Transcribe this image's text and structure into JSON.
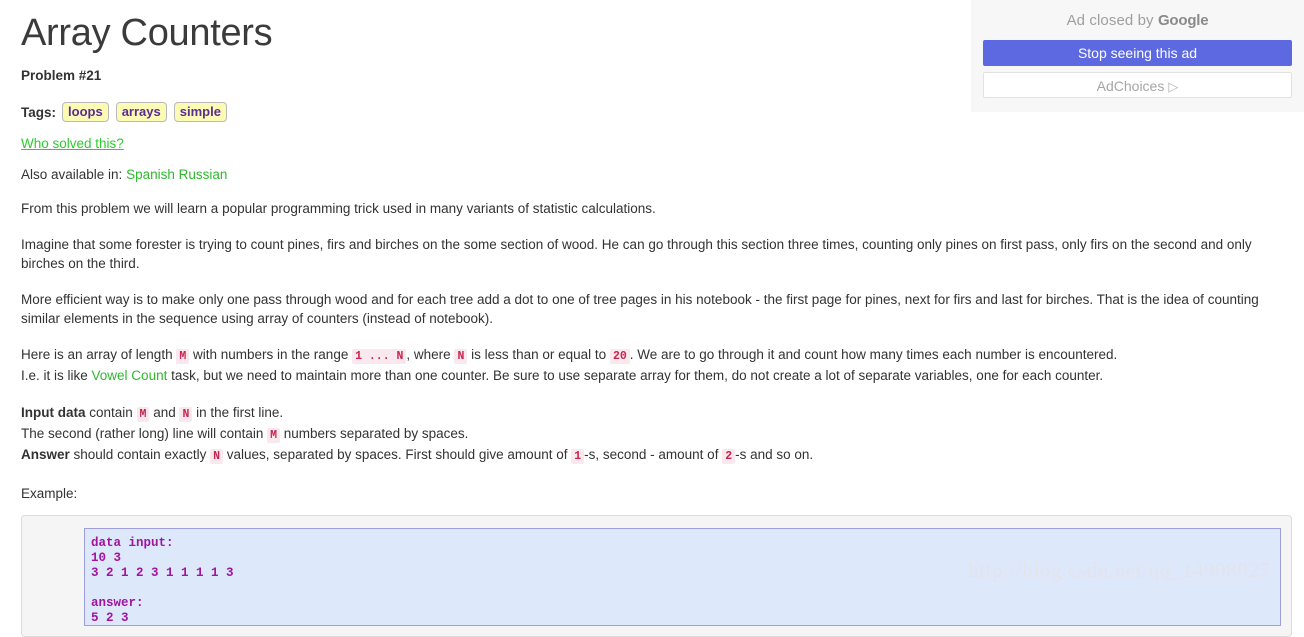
{
  "page": {
    "title": "Array Counters",
    "problem_number": "Problem #21",
    "tags_label": "Tags:",
    "tags": [
      "loops",
      "arrays",
      "simple"
    ],
    "who_solved_link": "Who solved this?",
    "also_available_prefix": "Also available in:",
    "languages": [
      "Spanish",
      "Russian"
    ],
    "example_label": "Example:"
  },
  "ad": {
    "closed_by_prefix": "Ad closed by ",
    "closed_by_brand": "Google",
    "stop_seeing_label": "Stop seeing this ad",
    "adchoices_label": "AdChoices",
    "adchoices_icon": "▷",
    "accent_color": "#5c69e0"
  },
  "paragraphs": {
    "p1": "From this problem we will learn a popular programming trick used in many variants of statistic calculations.",
    "p2": "Imagine that some forester is trying to count pines, firs and birches on the some section of wood. He can go through this section three times, counting only pines on first pass, only firs on the second and only birches on the third.",
    "p3": "More efficient way is to make only one pass through wood and for each tree add a dot to one of tree pages in his notebook - the first page for pines, next for firs and last for birches. That is the idea of counting similar elements in the sequence using array of counters (instead of notebook).",
    "p4_a": "Here is an array of length ",
    "p4_code_M": "M",
    "p4_b": " with numbers in the range ",
    "p4_code_range": "1 ... N",
    "p4_c": ", where ",
    "p4_code_N": "N",
    "p4_d": " is less than or equal to ",
    "p4_code_20": "20",
    "p4_e": ". We are to go through it and count how many times each number is encountered.",
    "p5_a": "I.e. it is like ",
    "p5_link": "Vowel Count",
    "p5_b": " task, but we need to maintain more than one counter. Be sure to use separate array for them, do not create a lot of separate variables, one for each counter."
  },
  "io": {
    "input_label": "Input data",
    "input_a": " contain ",
    "input_code_M": "M",
    "input_b": " and ",
    "input_code_N": "N",
    "input_c": " in the first line.",
    "second_line_a": "The second (rather long) line will contain ",
    "second_line_code_M": "M",
    "second_line_b": " numbers separated by spaces.",
    "answer_label": "Answer",
    "answer_a": " should contain exactly ",
    "answer_code_N": "N",
    "answer_b": " values, separated by spaces. First should give amount of ",
    "answer_code_1": "1",
    "answer_c": "-s, second - amount of ",
    "answer_code_2": "2",
    "answer_d": "-s and so on."
  },
  "example": {
    "code": "data input:\n10 3\n3 2 1 2 3 1 1 1 1 3\n\nanswer:\n5 2 3"
  },
  "watermark": {
    "text": "http://blog.csdn.net/qq_14908027"
  }
}
